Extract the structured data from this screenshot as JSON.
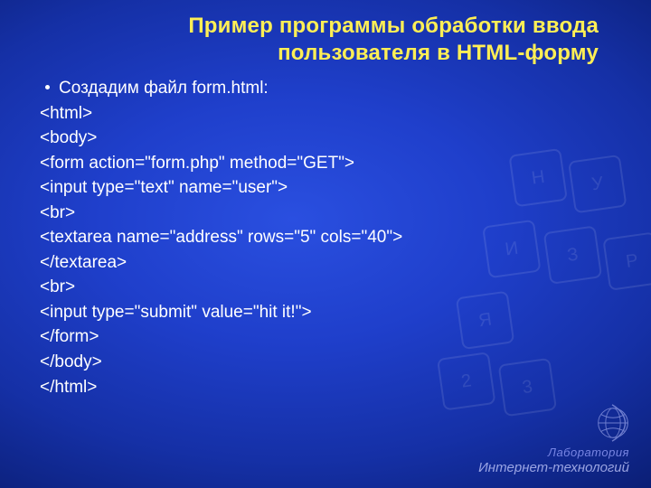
{
  "title_line1": "Пример программы обработки ввода",
  "title_line2": "пользователя в HTML-форму",
  "bullet": "Создадим файл form.html:",
  "code": [
    "<html>",
    "<body>",
    "<form action=\"form.php\" method=\"GET\">",
    "<input type=\"text\" name=\"user\">",
    "<br>",
    "<textarea name=\"address\" rows=\"5\" cols=\"40\">",
    "</textarea>",
    "<br>",
    "<input type=\"submit\" value=\"hit it!\">",
    "</form>",
    "</body>",
    "</html>"
  ],
  "footer": {
    "lab": "Лаборатория",
    "sub": "Интернет-технологий"
  },
  "keys": [
    "Н",
    "У",
    "И",
    "З",
    "Р",
    "Я",
    "2",
    "3"
  ]
}
